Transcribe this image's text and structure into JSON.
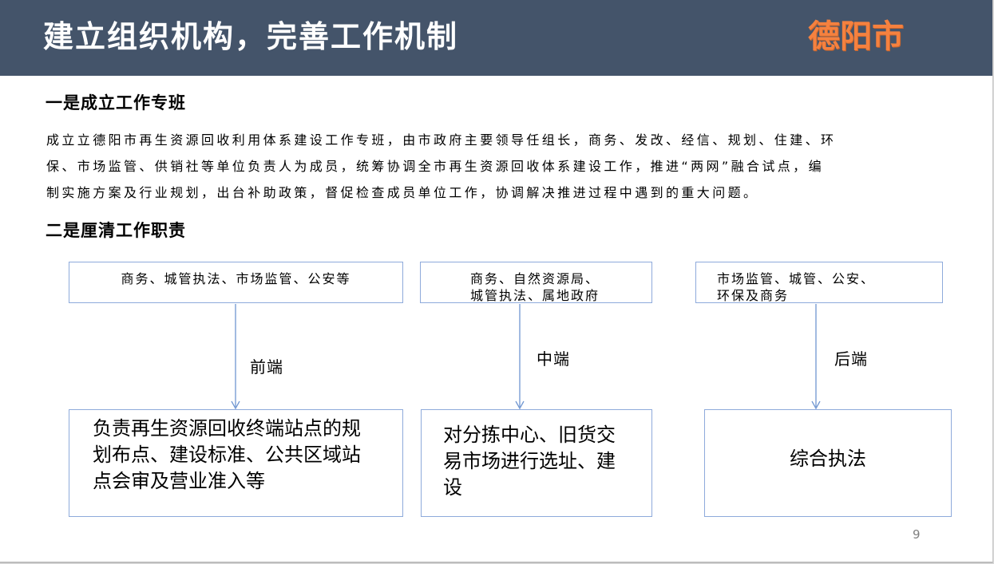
{
  "header": {
    "title": "建立组织机构，完善工作机制",
    "city": "德阳市"
  },
  "section1": {
    "heading": "一是成立工作专班",
    "lines": [
      "成立立德阳市再生资源回收利用体系建设工作专班，由市政府主要领导任组长，商务、发改、经信、规划、住建、环",
      "保、市场监管、供销社等单位负责人为成员，统筹协调全市再生资源回收体系建设工作，推进“两网”融合试点，编",
      "制实施方案及行业规划，出台补助政策，督促检查成员单位工作，协调解决推进过程中遇到的重大问题。"
    ]
  },
  "section2": {
    "heading": "二是厘清工作职责",
    "columns": [
      {
        "departments": [
          "商务、城管执法、市场监管、公安等"
        ],
        "stage": "前端",
        "duty": [
          "负责再生资源回收终端站点的规",
          "划布点、建设标准、公共区域站",
          "点会审及营业准入等"
        ]
      },
      {
        "departments": [
          "商务、自然资源局、",
          "城管执法、属地政府"
        ],
        "stage": "中端",
        "duty": [
          "对分拣中心、旧货交",
          "易市场进行选址、建",
          "设"
        ]
      },
      {
        "departments": [
          "市场监管、城管、公安、",
          "环保及商务"
        ],
        "stage": "后端",
        "duty": [
          "综合执法"
        ]
      }
    ]
  },
  "colors": {
    "header_bg": "#44546a",
    "city": "#f5813f",
    "box_border": "#8eaadb"
  },
  "page_number": "9"
}
